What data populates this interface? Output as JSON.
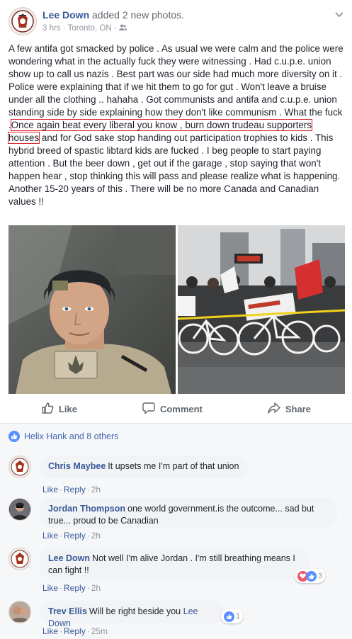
{
  "post": {
    "author": "Lee Down",
    "action": "added 2 new photos.",
    "time": "3 hrs",
    "location": "Toronto, ON",
    "separator": "·",
    "text_part1": "A few antifa got smacked by police . As usual we were calm and the police were wondering what in the actually fuck they were witnessing . Had c.u.p.e. union show up to call us nazis . Best part was our side had much more diversity on it . Police were explaining that if we hit them to go for gut . Won't leave a bruise under all the clothing .. hahaha . Got communists and antifa and c.u.p.e. union standing side by side explaining how they don't like communism . What the fuck .",
    "text_highlight": "Once again beat every liberal you know , burn down trudeau supporters houses",
    "text_part2": " and for God sake stop handing out participation trophies to kids . This hybrid breed of spastic libtard kids are fucked . I beg people to start paying attention . But the beer down , get out if the garage , stop saying that won't happen hear , stop thinking this will pass and please realize what is happening. Another 15-20 years of this . There will be no more Canada and Canadian values !!"
  },
  "actions": {
    "like": "Like",
    "comment": "Comment",
    "share": "Share"
  },
  "reactions": {
    "summary": "Helix Hank and 8 others"
  },
  "comments": [
    {
      "name": "Chris Maybee",
      "text": "It upsets me I'm part of that union",
      "like": "Like",
      "reply": "Reply",
      "time": "2h"
    },
    {
      "name": "Jordan Thompson",
      "text": "one world government.is the outcome... sad but true... proud to be Canadian",
      "like": "Like",
      "reply": "Reply",
      "time": "2h"
    },
    {
      "name": "Lee Down",
      "text": "Not well I'm alive Jordan . I'm still breathing means I can fight !!",
      "like": "Like",
      "reply": "Reply",
      "time": "2h",
      "reaction_count": "3"
    },
    {
      "name": "Trev Ellis",
      "text": "Will be right beside you",
      "tag": "Lee Down",
      "like": "Like",
      "reply": "Reply",
      "time": "25m",
      "reaction_count": "1"
    }
  ],
  "colors": {
    "link": "#365899",
    "highlight_box": "#d9222a",
    "like_blue": "#5890ff",
    "love_red": "#f25268"
  },
  "icons": {
    "privacy": "friends-icon",
    "menu": "chevron-down-icon",
    "like": "thumbs-up-icon",
    "comment": "comment-bubble-icon",
    "share": "share-arrow-icon"
  }
}
